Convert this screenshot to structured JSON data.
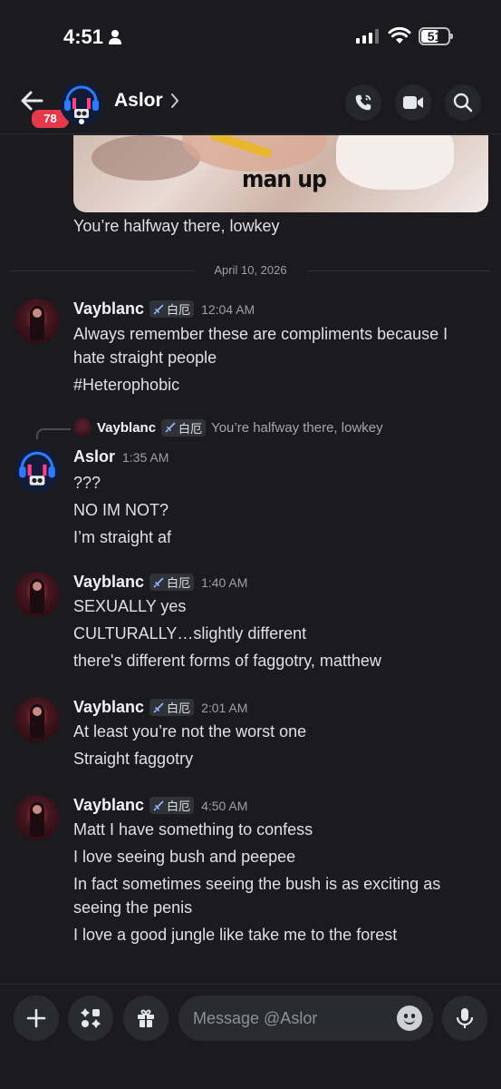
{
  "status_bar": {
    "time": "4:51",
    "battery": "51"
  },
  "header": {
    "unread_count": "78",
    "channel_name": "Aslor"
  },
  "previous": {
    "embed_caption": "man up",
    "last_line": "You’re halfway there, lowkey"
  },
  "date_separator": "April 10, 2026",
  "messages": [
    {
      "author": "Vayblanc",
      "tag": "白厄",
      "time": "12:04 AM",
      "lines": [
        "Always remember these are compliments because I",
        "hate straight people",
        "#Heterophobic"
      ]
    },
    {
      "author": "Aslor",
      "time": "1:35 AM",
      "reply": {
        "author": "Vayblanc",
        "tag": "白厄",
        "text": "You’re halfway there, lowkey"
      },
      "lines": [
        "???",
        "NO IM NOT?",
        "I’m straight af"
      ]
    },
    {
      "author": "Vayblanc",
      "tag": "白厄",
      "time": "1:40 AM",
      "lines": [
        "SEXUALLY yes",
        "CULTURALLY…slightly different",
        "there's different forms of faggotry, matthew"
      ]
    },
    {
      "author": "Vayblanc",
      "tag": "白厄",
      "time": "2:01 AM",
      "lines": [
        "At least you’re not the worst one",
        "Straight faggotry"
      ]
    },
    {
      "author": "Vayblanc",
      "tag": "白厄",
      "time": "4:50 AM",
      "lines": [
        "Matt I have something to confess",
        "I love seeing bush and peepee",
        "In fact sometimes seeing the bush is as exciting as",
        "seeing the penis",
        "I love a good jungle like take me to the forest"
      ]
    }
  ],
  "composer": {
    "placeholder": "Message @Aslor"
  },
  "colors": {
    "background": "#1b1b1f",
    "badge": "#e3394a",
    "surface": "#2a2b30"
  }
}
